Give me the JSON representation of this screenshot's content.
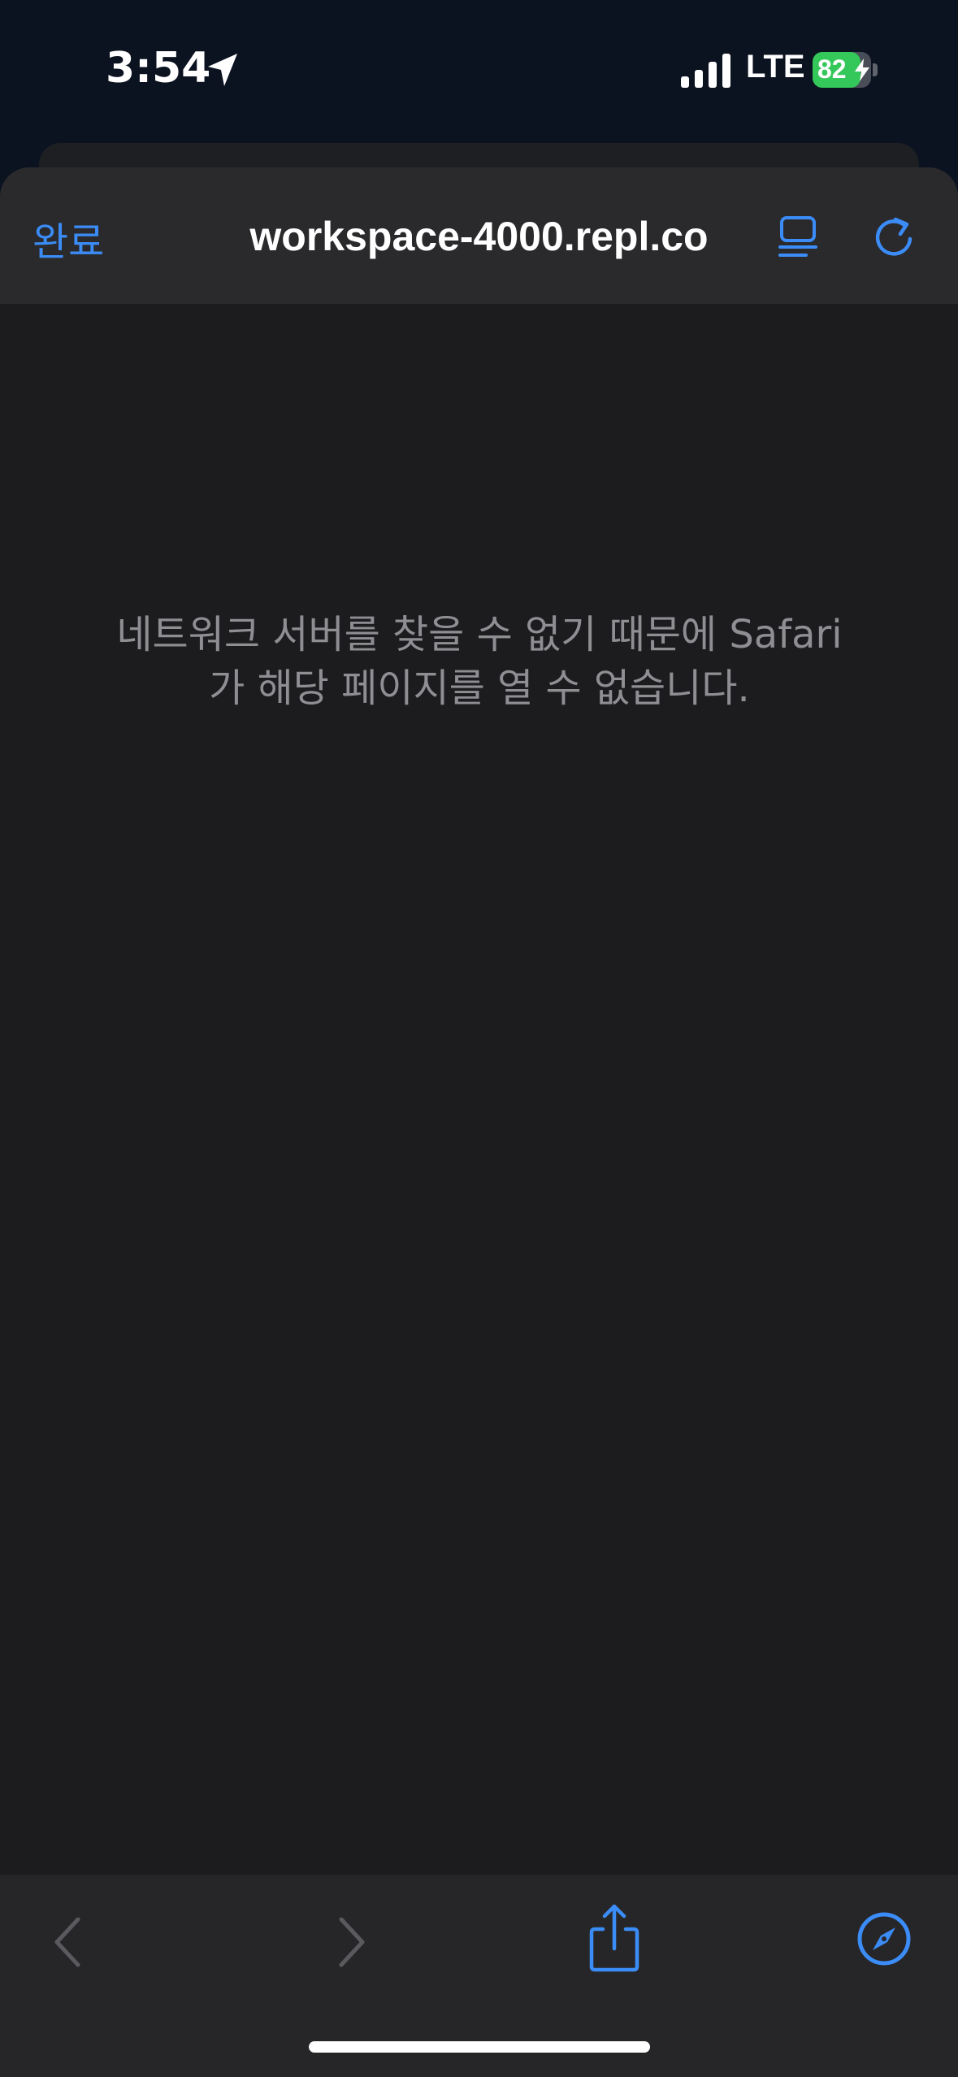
{
  "status_bar": {
    "time": "3:54",
    "network": "LTE",
    "battery_level": "82",
    "battery_fraction": 0.82,
    "icons": [
      "location-arrow-icon",
      "signal-bars-icon",
      "battery-icon",
      "charging-bolt-icon"
    ]
  },
  "browser": {
    "done_label": "완료",
    "url": "workspace-4000.repl.co",
    "error_line1": "네트워크 서버를 찾을 수 없기 때문에 Safari",
    "error_line2": "가 해당 페이지를 열 수 없습니다.",
    "icons": [
      "reader-mode-icon",
      "reload-icon"
    ]
  },
  "bottom_toolbar": {
    "icons": [
      "back-chevron-icon",
      "forward-chevron-icon",
      "share-icon",
      "compass-icon"
    ]
  },
  "colors": {
    "accent": "#3b8cf7",
    "background": "#1c1c1e",
    "toolbar": "#2a2a2c",
    "status_bg": "#0b1220",
    "battery_green": "#34c759",
    "muted_text": "#8e8e93"
  }
}
